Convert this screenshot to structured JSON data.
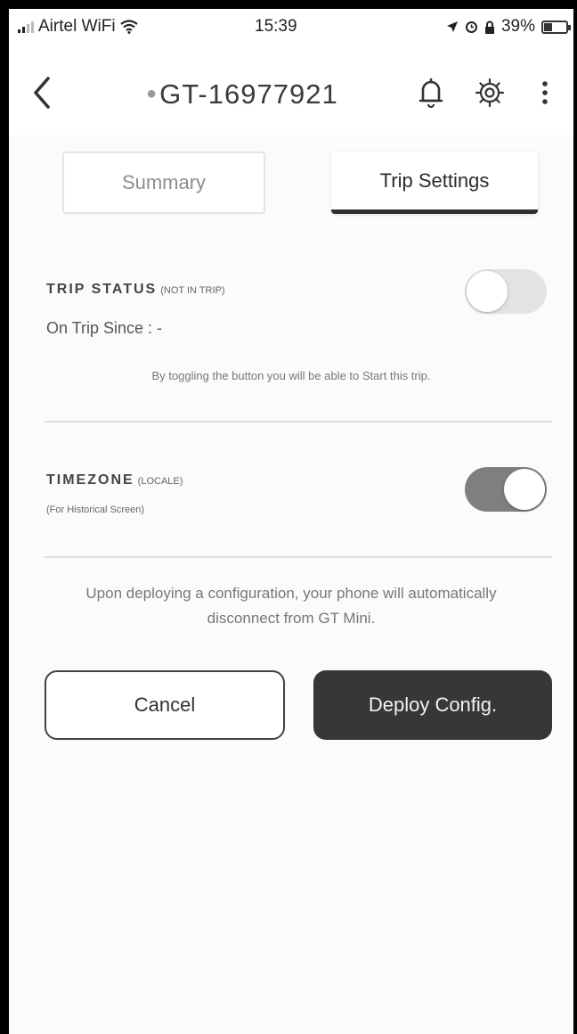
{
  "status_bar": {
    "carrier": "Airtel WiFi",
    "time": "15:39",
    "battery": "39%",
    "icons": [
      "signal-icon",
      "wifi-icon",
      "location-icon",
      "alarm-icon",
      "lock-icon",
      "battery-icon"
    ]
  },
  "header": {
    "title": "GT-16977921",
    "icons": [
      "back-chevron-icon",
      "bell-icon",
      "gear-icon",
      "more-vertical-icon"
    ]
  },
  "tabs": [
    {
      "label": "Summary",
      "active": false
    },
    {
      "label": "Trip Settings",
      "active": true
    }
  ],
  "trip_status": {
    "label": "TRIP STATUS",
    "label_suffix": "(NOT IN TRIP)",
    "on_trip_since": "On Trip Since : -",
    "hint": "By toggling the button you will be able to Start this trip.",
    "toggle_on": false
  },
  "timezone": {
    "label": "TIMEZONE",
    "label_suffix": "(LOCALE)",
    "sub": "(For Historical Screen)",
    "toggle_on": true
  },
  "note": "Upon deploying a configuration, your phone will automatically disconnect from GT Mini.",
  "buttons": {
    "cancel": "Cancel",
    "deploy": "Deploy Config."
  },
  "colors": {
    "background": "#fbfbfb",
    "primary_button": "#373737",
    "toggle_on": "#7f7f7f",
    "toggle_off": "#e3e3e3"
  }
}
